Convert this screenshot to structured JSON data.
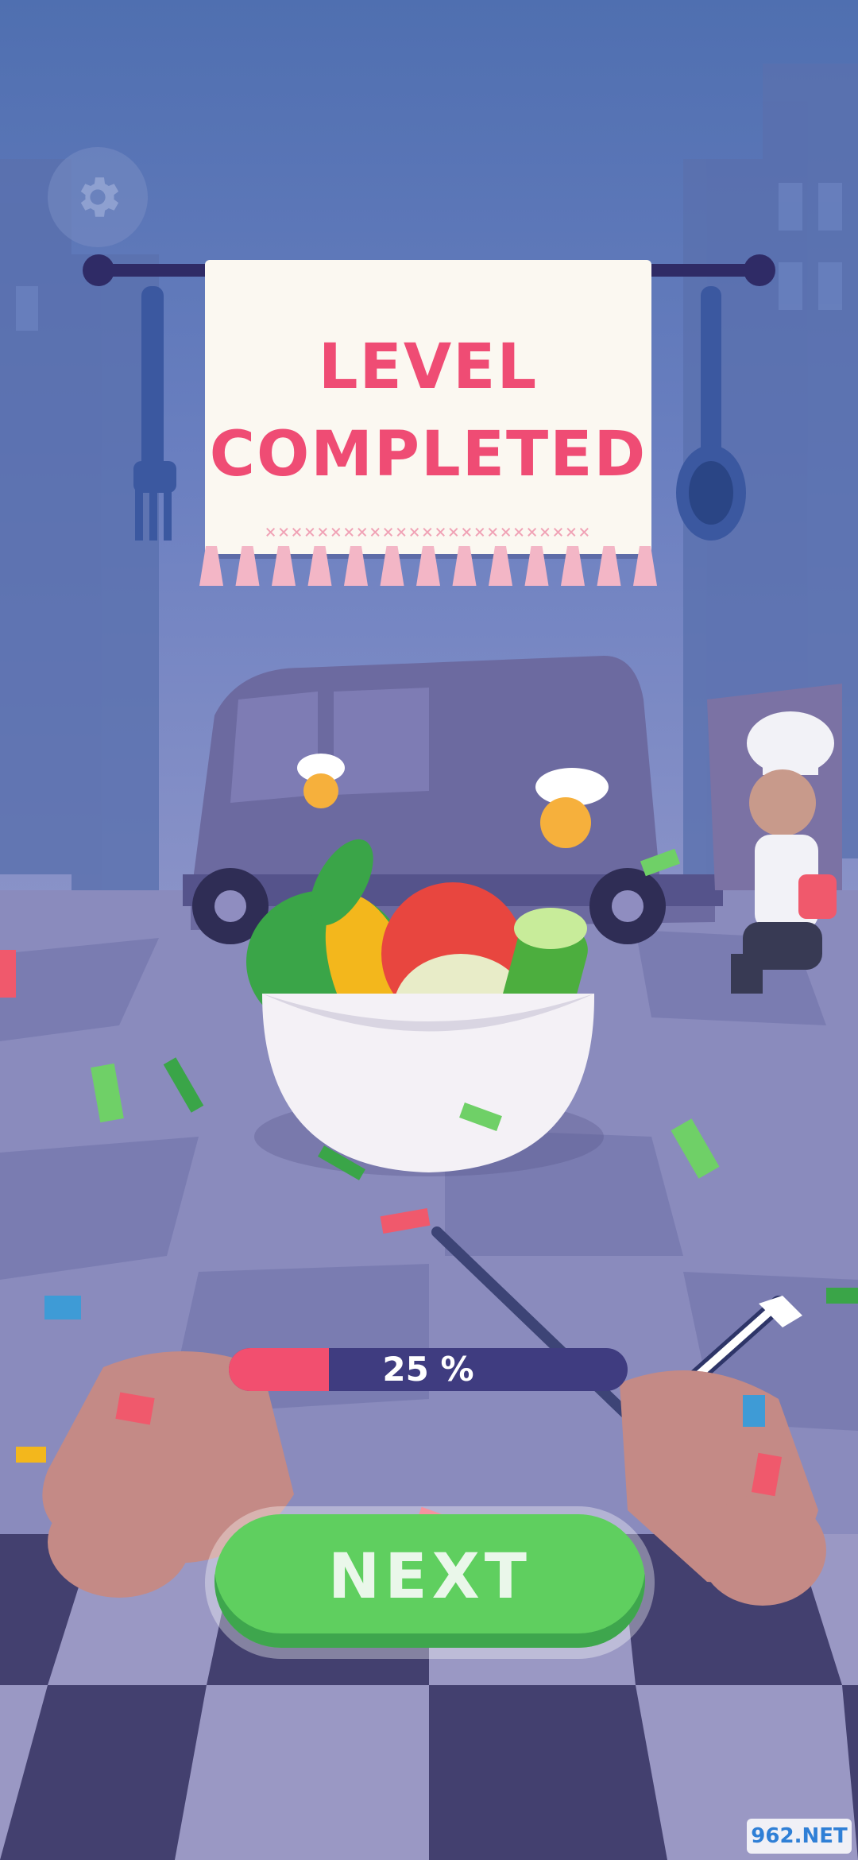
{
  "banner": {
    "title_line1": "LEVEL",
    "title_line2": "COMPLETED",
    "stitch": "×××××××××××××××××××××××××"
  },
  "progress": {
    "value": 0.25,
    "label": "25 %"
  },
  "next_button": {
    "label": "NEXT"
  },
  "settings": {
    "icon": "gear-icon"
  },
  "watermark": {
    "text": "962.NET"
  },
  "colors": {
    "accent": "#ef4c74",
    "progress_fill": "#f24f6f",
    "progress_track": "#3f3c80",
    "button_green": "#5fcf5f"
  }
}
